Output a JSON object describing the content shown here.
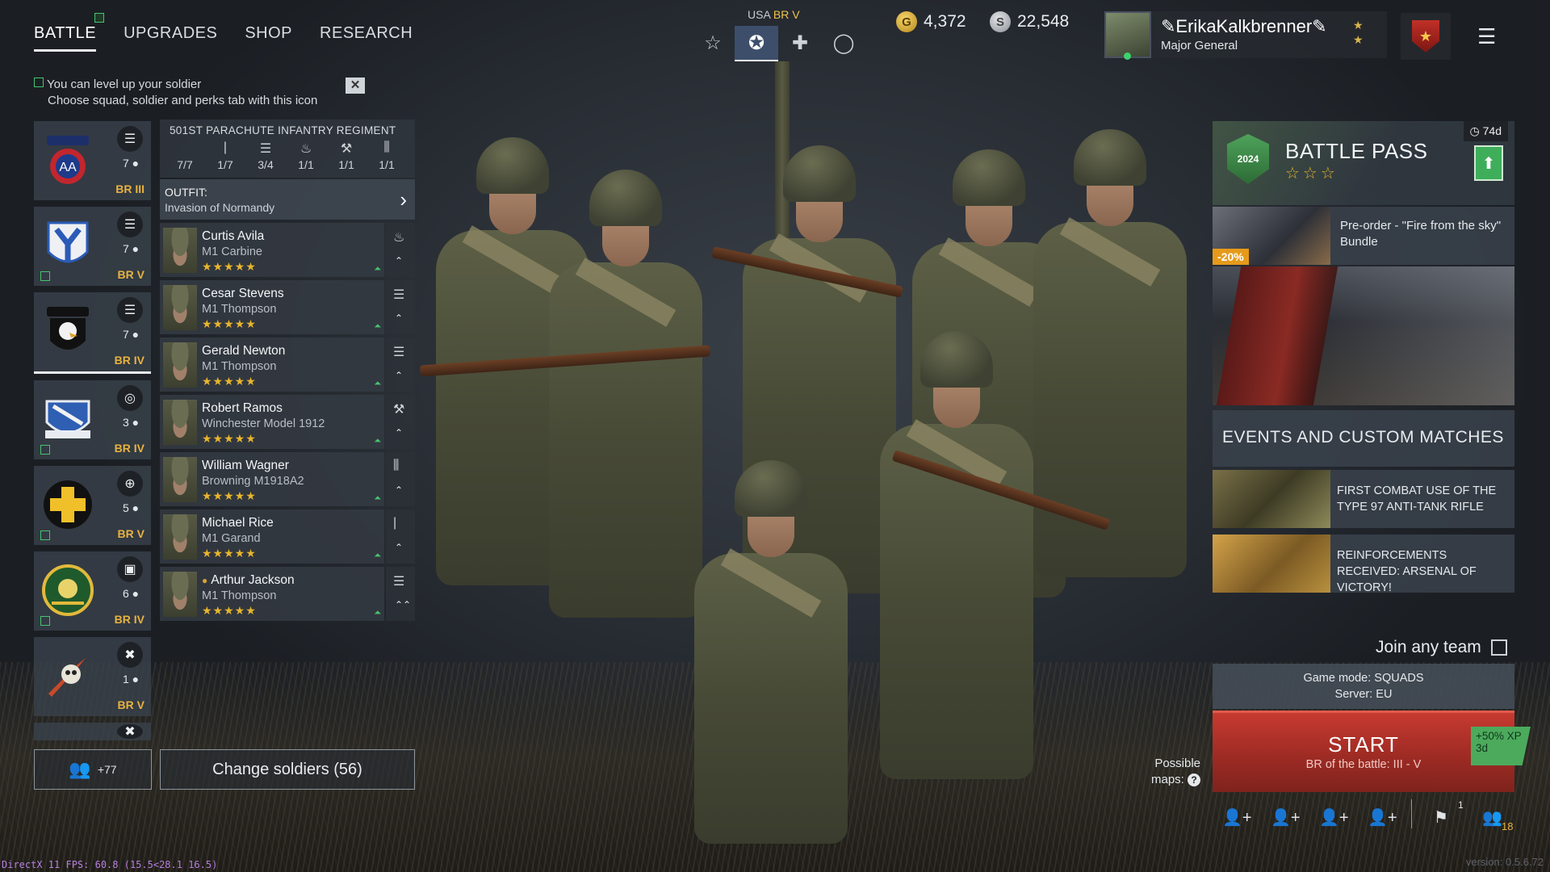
{
  "nav": {
    "tabs": [
      {
        "label": "BATTLE",
        "active": true
      },
      {
        "label": "UPGRADES"
      },
      {
        "label": "SHOP"
      },
      {
        "label": "RESEARCH"
      }
    ]
  },
  "hint": {
    "line1": "You can level up your soldier",
    "line2": "Choose squad, soldier and perks tab with this icon",
    "close": "✕"
  },
  "nation": {
    "country": "USA",
    "br": "BR V"
  },
  "mode_icons": [
    "star-outline-icon",
    "star-badge-icon",
    "cross-icon",
    "circle-icon"
  ],
  "currency": {
    "gold": "4,372",
    "silver": "22,548",
    "gold_symbol": "G",
    "silver_symbol": "S"
  },
  "profile": {
    "name": "✎ErikaKalkbrenner✎",
    "rank": "Major General"
  },
  "squads": [
    {
      "count": "7",
      "br": "BR III",
      "icon": "list-icon",
      "emblem": "airborne-82nd-icon",
      "upgrade": false
    },
    {
      "count": "7",
      "br": "BR V",
      "icon": "list-icon",
      "emblem": "y-shield-icon",
      "upgrade": true
    },
    {
      "count": "7",
      "br": "BR IV",
      "icon": "list-icon",
      "emblem": "airborne-eagle-icon",
      "upgrade": false,
      "active": true
    },
    {
      "count": "3",
      "br": "BR IV",
      "icon": "target-icon",
      "emblem": "crest-shield-icon",
      "upgrade": true
    },
    {
      "count": "5",
      "br": "BR V",
      "icon": "plus-circle-icon",
      "emblem": "yellow-cross-icon",
      "upgrade": true
    },
    {
      "count": "6",
      "br": "BR IV",
      "icon": "vehicle-icon",
      "emblem": "cavalry-badge-icon",
      "upgrade": true
    },
    {
      "count": "1",
      "br": "BR V",
      "icon": "wrench-cross-icon",
      "emblem": "rocket-skull-icon",
      "upgrade": false
    }
  ],
  "squad_panel": {
    "title": "501ST PARACHUTE INFANTRY REGIMENT",
    "stats": [
      {
        "icon": "lock-person-icon",
        "value": "7/7"
      },
      {
        "icon": "rifle-icon",
        "value": "1/7"
      },
      {
        "icon": "list-icon",
        "value": "3/4"
      },
      {
        "icon": "flame-icon",
        "value": "1/1"
      },
      {
        "icon": "wrench-icon",
        "value": "1/1"
      },
      {
        "icon": "ammo-icon",
        "value": "1/1"
      }
    ],
    "outfit_label": "OUTFIT:",
    "outfit_name": "Invasion of Normandy",
    "soldiers": [
      {
        "name": "Curtis Avila",
        "weapon": "M1 Carbine",
        "stars": "★★★★★",
        "role_icon": "flame-icon",
        "chevron": "⌃"
      },
      {
        "name": "Cesar Stevens",
        "weapon": "M1 Thompson",
        "stars": "★★★★★",
        "role_icon": "list-icon",
        "chevron": "⌃"
      },
      {
        "name": "Gerald Newton",
        "weapon": "M1 Thompson",
        "stars": "★★★★★",
        "role_icon": "list-icon",
        "chevron": "⌃"
      },
      {
        "name": "Robert Ramos",
        "weapon": "Winchester Model 1912",
        "stars": "★★★★★",
        "role_icon": "wrench-icon",
        "chevron": "⌃"
      },
      {
        "name": "William Wagner",
        "weapon": "Browning M1918A2",
        "stars": "★★★★★",
        "role_icon": "ammo-icon",
        "chevron": "⌃"
      },
      {
        "name": "Michael Rice",
        "weapon": "M1 Garand",
        "stars": "★★★★★",
        "role_icon": "rifle-icon",
        "chevron": "⌃"
      },
      {
        "name": "Arthur Jackson",
        "weapon": "M1 Thompson",
        "stars": "★★★★★",
        "role_icon": "list-icon",
        "chevron": "⌃⌃"
      }
    ]
  },
  "reserve": {
    "label": "+77"
  },
  "change_soldiers": "Change soldiers (56)",
  "battle_pass": {
    "title": "BATTLE PASS",
    "stars": "☆☆☆",
    "timer": "74d",
    "year": "2024"
  },
  "promo": {
    "discount": "-20%",
    "text": "Pre-order - \"Fire from the sky\" Bundle"
  },
  "events": {
    "header": "EVENTS AND CUSTOM MATCHES",
    "items": [
      {
        "text": "FIRST COMBAT USE OF THE TYPE 97 ANTI-TANK RIFLE"
      },
      {
        "text": "REINFORCEMENTS RECEIVED: ARSENAL OF VICTORY!"
      }
    ]
  },
  "join_any_team": "Join any team",
  "game_mode": "Game mode: SQUADS",
  "server": "Server: EU",
  "start": {
    "label": "START",
    "sub": "BR of the battle: III - V",
    "xp": "+50% XP",
    "xp_time": "3d"
  },
  "possible_maps": {
    "line1": "Possible",
    "line2": "maps:",
    "q": "?"
  },
  "party": {
    "flag_count": "1",
    "online_count": "18"
  },
  "debug": "DirectX 11 FPS: 60.8 (15.5<28.1 16.5)",
  "version": "version: 0.5.6.72",
  "colors": {
    "accent_gold": "#e8b240",
    "start_red": "#c73a30",
    "upgrade_green": "#45c46e"
  }
}
